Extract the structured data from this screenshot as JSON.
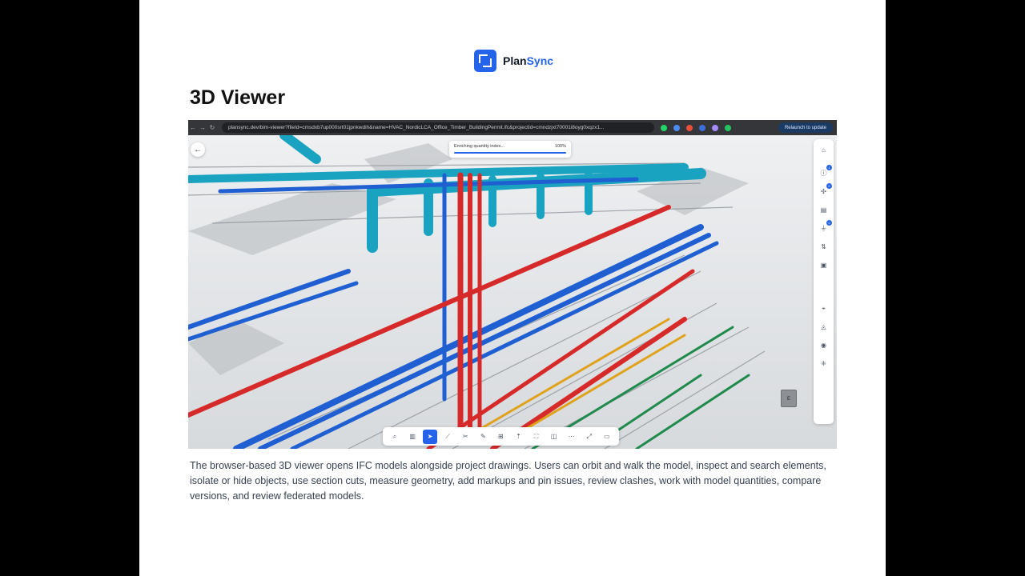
{
  "brand": {
    "name_part1": "Plan",
    "name_part2": "Sync"
  },
  "page_title": "3D Viewer",
  "browser": {
    "url": "plansync.dev/bim-viewer?fileId=cmsdxb7up000srt01jpnkwdih&name=HVAC_NordicLCA_Office_Timber_BuildingPermit.ifc&projectId=cmndzjxt70001i8oyg0xqzx1...",
    "relaunch_label": "Relaunch to update"
  },
  "progress": {
    "label": "Enriching quantity index...",
    "percent_text": "100%",
    "percent": 100
  },
  "right_toolbar": [
    {
      "icon": "home-icon",
      "glyph": "⌂",
      "badge": ""
    },
    {
      "icon": "info-icon",
      "glyph": "ⓘ",
      "badge": "1"
    },
    {
      "icon": "clash-icon",
      "glyph": "✣",
      "badge": "0"
    },
    {
      "icon": "table-icon",
      "glyph": "▤",
      "badge": ""
    },
    {
      "icon": "filter-icon",
      "glyph": "⏚",
      "badge": "0"
    },
    {
      "icon": "compare-icon",
      "glyph": "⇅",
      "badge": ""
    },
    {
      "icon": "clipboard-icon",
      "glyph": "▣",
      "badge": ""
    },
    {
      "icon": "focus-icon",
      "glyph": "⌖",
      "badge": ""
    },
    {
      "icon": "layers-icon",
      "glyph": "◬",
      "badge": ""
    },
    {
      "icon": "eye-icon",
      "glyph": "◉",
      "badge": ""
    },
    {
      "icon": "explode-icon",
      "glyph": "⁜",
      "badge": ""
    }
  ],
  "bottom_toolbar": [
    {
      "icon": "search-icon",
      "glyph": "⌕",
      "active": false
    },
    {
      "icon": "chart-icon",
      "glyph": "▥",
      "active": false
    },
    {
      "icon": "select-cursor-icon",
      "glyph": "➤",
      "active": true
    },
    {
      "icon": "measure-icon",
      "glyph": "⟋",
      "active": false
    },
    {
      "icon": "section-cut-icon",
      "glyph": "✂",
      "active": false
    },
    {
      "icon": "markup-pen-icon",
      "glyph": "✎",
      "active": false
    },
    {
      "icon": "grid-icon",
      "glyph": "⊞",
      "active": false
    },
    {
      "icon": "walk-icon",
      "glyph": "⇡",
      "active": false
    },
    {
      "icon": "fit-view-icon",
      "glyph": "⛶",
      "active": false
    },
    {
      "icon": "split-view-icon",
      "glyph": "◫",
      "active": false
    },
    {
      "icon": "more-icon",
      "glyph": "⋯",
      "active": false
    },
    {
      "icon": "fullscreen-icon",
      "glyph": "⤢",
      "active": false
    },
    {
      "icon": "monitor-icon",
      "glyph": "▭",
      "active": false
    }
  ],
  "viewcube_label": "E",
  "description": "The browser-based 3D viewer opens IFC models alongside project drawings. Users can orbit and walk the model, inspect and search elements, isolate or hide objects, use section cuts, measure geometry, add markups and pin issues, review clashes, work with model quantities, compare versions, and review federated models.",
  "colors": {
    "accent": "#2563eb",
    "pipe_blue": "#1f5fd1",
    "pipe_red": "#d62a2a",
    "pipe_cyan": "#1aa3c1",
    "pipe_green": "#1f8a4c",
    "pipe_yellow": "#e0a21a"
  }
}
